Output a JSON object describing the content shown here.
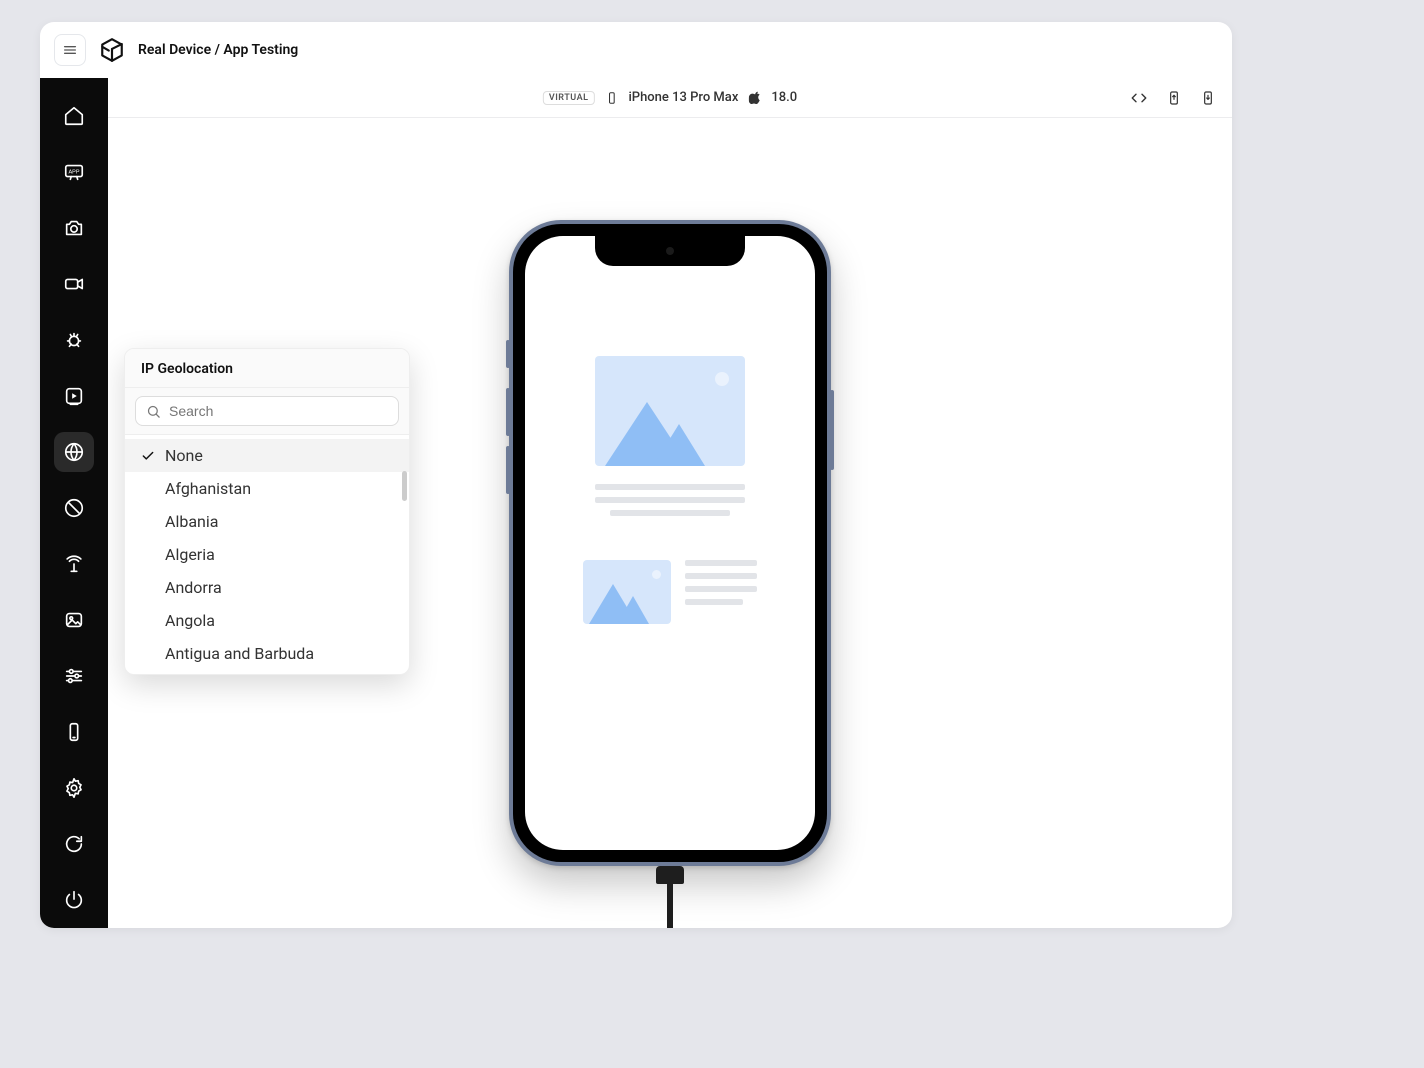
{
  "header": {
    "title": "Real Device / App Testing"
  },
  "deviceBar": {
    "badge": "VIRTUAL",
    "deviceName": "iPhone 13 Pro Max",
    "osVersion": "18.0"
  },
  "sidebar": {
    "items": [
      {
        "name": "home-icon"
      },
      {
        "name": "app-icon"
      },
      {
        "name": "camera-icon"
      },
      {
        "name": "video-icon"
      },
      {
        "name": "bug-icon"
      },
      {
        "name": "play-icon"
      },
      {
        "name": "globe-icon",
        "active": true
      },
      {
        "name": "map-icon"
      },
      {
        "name": "network-icon"
      },
      {
        "name": "image-icon"
      },
      {
        "name": "sliders-icon"
      },
      {
        "name": "device-icon"
      },
      {
        "name": "settings-icon"
      },
      {
        "name": "refresh-icon"
      },
      {
        "name": "power-icon"
      }
    ]
  },
  "geolocation": {
    "title": "IP Geolocation",
    "searchPlaceholder": "Search",
    "selected": "None",
    "options": [
      "None",
      "Afghanistan",
      "Albania",
      "Algeria",
      "Andorra",
      "Angola",
      "Antigua and Barbuda"
    ]
  }
}
